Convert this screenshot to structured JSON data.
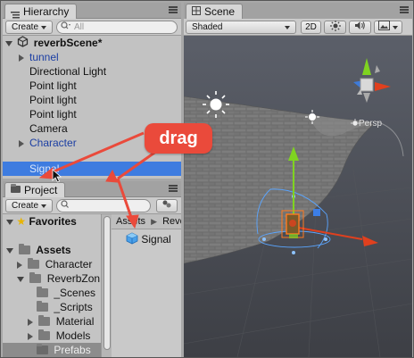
{
  "hierarchy": {
    "tab_label": "Hierarchy",
    "create_label": "Create",
    "search_placeholder": "All",
    "scene_name": "reverbScene*",
    "items": [
      {
        "label": "tunnel"
      },
      {
        "label": "Directional Light"
      },
      {
        "label": "Point light"
      },
      {
        "label": "Point light"
      },
      {
        "label": "Point light"
      },
      {
        "label": "Camera"
      },
      {
        "label": "Character"
      },
      {
        "label": "Signal"
      }
    ]
  },
  "project": {
    "tab_label": "Project",
    "create_label": "Create",
    "favorites_label": "Favorites",
    "assets_label": "Assets",
    "breadcrumb": {
      "root": "Assets",
      "sub": "Reve"
    },
    "tree": [
      {
        "label": "Character"
      },
      {
        "label": "ReverbZon"
      },
      {
        "label": "_Scenes"
      },
      {
        "label": "_Scripts"
      },
      {
        "label": "Material"
      },
      {
        "label": "Models"
      },
      {
        "label": "Prefabs"
      }
    ],
    "content_items": [
      {
        "label": "Signal"
      }
    ]
  },
  "scene": {
    "tab_label": "Scene",
    "shading_mode": "Shaded",
    "mode_2d_label": "2D",
    "view_label": "Persp"
  },
  "annotation": {
    "callout_text": "drag",
    "color": "#ea4a3b"
  },
  "colors": {
    "selection": "#3e7ce0",
    "panel": "#c2c2c2",
    "viewport_bg": "#3b3c40",
    "gizmo_green": "#7fd320",
    "gizmo_red": "#e0401e",
    "gizmo_blue": "#3c7ee6"
  }
}
